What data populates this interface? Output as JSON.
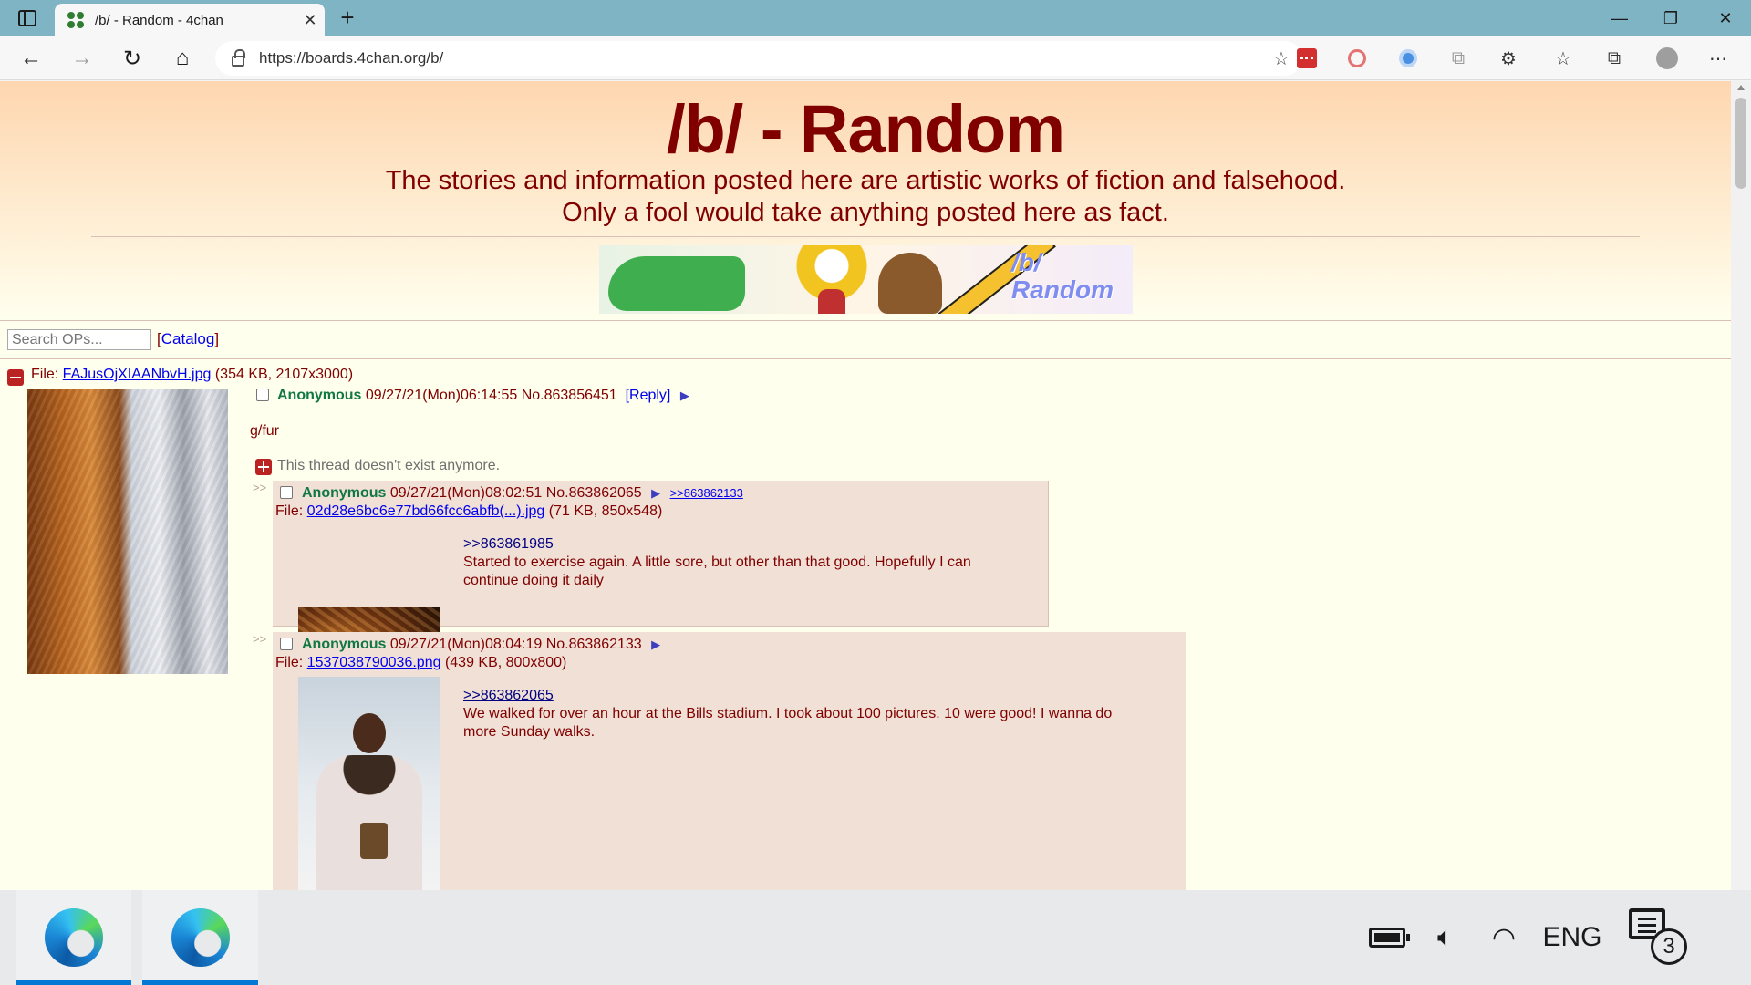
{
  "browser": {
    "tab_title": "/b/ - Random - 4chan",
    "tab_close": "✕",
    "new_tab": "+",
    "url": "https://boards.4chan.org/b/",
    "window_controls": {
      "minimize": "—",
      "maximize": "❐",
      "close": "✕"
    },
    "nav": {
      "back": "←",
      "forward": "→",
      "refresh": "↻",
      "home": "⌂"
    },
    "addr_icon": "☆",
    "toolbar_icons": [
      "red-password-extension-icon",
      "red-block-extension-icon",
      "blue-dot-extension-icon",
      "gray-extension-icon",
      "extensions-puzzle-icon",
      "favorites-icon",
      "collections-icon",
      "profile-avatar-icon",
      "more-menu-icon"
    ],
    "toolbar_glyphs": {
      "gray_ext": "⧉",
      "puzzle": "⚙",
      "favorites": "☆",
      "collections": "⧉",
      "more": "⋯"
    }
  },
  "board": {
    "title": "/b/ - Random",
    "subtitle_line1": "The stories and information posted here are artistic works of fiction and falsehood.",
    "subtitle_line2": "Only a fool would take anything posted here as fact.",
    "banner_label_1": "/b/",
    "banner_label_2": "Random",
    "search_placeholder": "Search OPs...",
    "catalog_open": "[",
    "catalog_label": "Catalog",
    "catalog_close": "]"
  },
  "thread": {
    "file_prefix": "File: ",
    "file_name": "FAJusOjXIAANbvH.jpg",
    "file_meta": " (354 KB, 2107x3000)",
    "op_name": "Anonymous",
    "op_datetime": "09/27/21(Mon)06:14:55",
    "op_no": "No.863856451",
    "reply_link": "[Reply]",
    "menu_glyph": "▶",
    "op_comment": "g/fur",
    "gone_notice": "This thread doesn't exist anymore."
  },
  "replies": [
    {
      "arrows": ">>",
      "name": "Anonymous",
      "datetime": "09/27/21(Mon)08:02:51",
      "no": "No.863862065",
      "backlink": ">>863862133",
      "file_prefix": "File: ",
      "file_name": "02d28e6bc6e77bd66fcc6abfb(...).jpg",
      "file_meta": " (71 KB, 850x548)",
      "quote": ">>863861985",
      "comment": "Started to exercise again. A little sore, but other than that good. Hopefully I can continue doing it daily"
    },
    {
      "arrows": ">>",
      "name": "Anonymous",
      "datetime": "09/27/21(Mon)08:04:19",
      "no": "No.863862133",
      "file_prefix": "File: ",
      "file_name": "1537038790036.png",
      "file_meta": " (439 KB, 800x800)",
      "quote": ">>863862065",
      "comment": "We walked for over an hour at the Bills stadium. I took about 100 pictures. 10 were good! I wanna do more Sunday walks."
    }
  ],
  "taskbar": {
    "apps": [
      "edge-browser-icon",
      "edge-browser-icon"
    ],
    "volume_glyph": "🔈︎",
    "wifi_glyph": "◠",
    "language": "ENG",
    "notification_count": "3"
  },
  "colors": {
    "board_title": "#800000",
    "name_green": "#117743",
    "link_blue": "#0000ee",
    "reply_bg": "#f0e0d6",
    "taskbar_accent": "#0078d4"
  }
}
